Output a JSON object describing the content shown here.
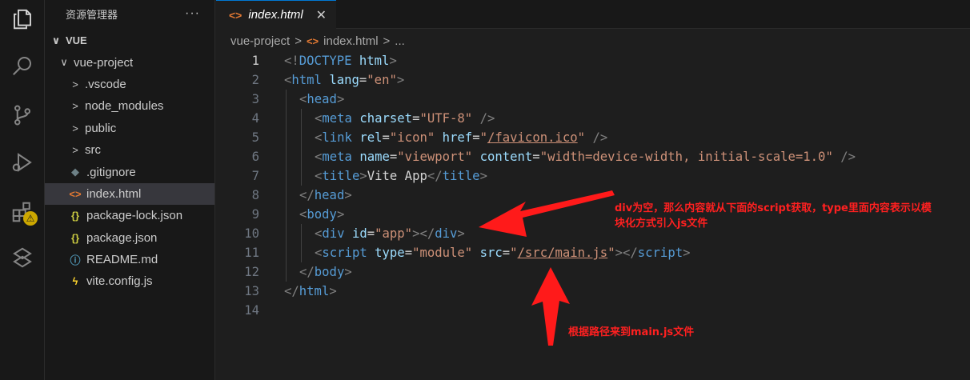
{
  "explorer": {
    "title": "资源管理器",
    "more": "···",
    "section": "VUE",
    "items": [
      {
        "label": "vue-project",
        "chevron": "∨",
        "icon": ""
      },
      {
        "label": ".vscode",
        "chevron": ">",
        "icon": ""
      },
      {
        "label": "node_modules",
        "chevron": ">",
        "icon": ""
      },
      {
        "label": "public",
        "chevron": ">",
        "icon": ""
      },
      {
        "label": "src",
        "chevron": ">",
        "icon": ""
      },
      {
        "label": ".gitignore",
        "chevron": "",
        "icon": "◆"
      },
      {
        "label": "index.html",
        "chevron": "",
        "icon": "<>"
      },
      {
        "label": "package-lock.json",
        "chevron": "",
        "icon": "{}"
      },
      {
        "label": "package.json",
        "chevron": "",
        "icon": "{}"
      },
      {
        "label": "README.md",
        "chevron": "",
        "icon": "ⓘ"
      },
      {
        "label": "vite.config.js",
        "chevron": "",
        "icon": "ϟ"
      }
    ]
  },
  "tab": {
    "label": "index.html",
    "icon": "<>",
    "close": "✕"
  },
  "breadcrumb": {
    "folder": "vue-project",
    "sep1": ">",
    "icon": "<>",
    "file": "index.html",
    "sep2": ">",
    "more": "..."
  },
  "editor": {
    "line_numbers": [
      "1",
      "2",
      "3",
      "4",
      "5",
      "6",
      "7",
      "8",
      "9",
      "10",
      "11",
      "12",
      "13",
      "14"
    ]
  },
  "annotations": {
    "div_note_line1": "div为空，那么内容就从下面的script获取，type里面内容表示以模",
    "div_note_line2": "块化方式引入js文件",
    "path_note": "根据路径来到main.js文件"
  },
  "colors": {
    "tag": "#569cd6",
    "attr": "#9cdcfe",
    "string": "#ce9178",
    "bracket": "#808080",
    "annotation": "#ff2020",
    "selection": "#37373d",
    "accent": "#0078d4"
  }
}
